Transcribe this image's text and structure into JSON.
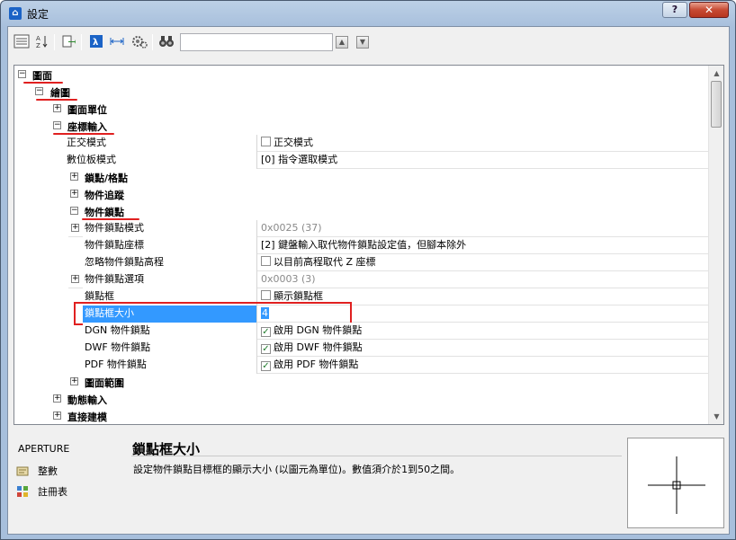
{
  "window": {
    "title": "設定",
    "help_label": "?",
    "close_label": "✕"
  },
  "toolbar": {
    "buttons": [
      "view-toggle-icon",
      "sort-az-icon",
      "export-icon",
      "drawing-icon",
      "dimension-icon",
      "settings-gear-icon",
      "binoculars-icon"
    ],
    "search_value": "",
    "up_label": "▲",
    "down_label": "▼"
  },
  "tree": {
    "root": "圖面",
    "drawing": "繪圖",
    "units": "圖面單位",
    "coord_input": "座標輸入",
    "ortho": {
      "name": "正交模式",
      "value": "正交模式",
      "checked": false
    },
    "tablet": {
      "name": "數位板模式",
      "value": "[0] 指令選取模式"
    },
    "snap_grid": "鎖點/格點",
    "tracking": "物件追蹤",
    "osnap": "物件鎖點",
    "osnap_mode": {
      "name": "物件鎖點模式",
      "value": "0x0025 (37)"
    },
    "osnap_coords": {
      "name": "物件鎖點座標",
      "value": "[2] 鍵盤輸入取代物件鎖點設定值，但腳本除外"
    },
    "osnap_elev": {
      "name": "忽略物件鎖點高程",
      "value": "以目前高程取代 Z 座標",
      "checked": false
    },
    "osnap_options": {
      "name": "物件鎖點選項",
      "value": "0x0003 (3)"
    },
    "aperture_box": {
      "name": "鎖點框",
      "value": "顯示鎖點框",
      "checked": false
    },
    "aperture_size": {
      "name": "鎖點框大小",
      "value": "4"
    },
    "dgn_snap": {
      "name": "DGN 物件鎖點",
      "value": "啟用 DGN 物件鎖點",
      "checked": true
    },
    "dwf_snap": {
      "name": "DWF 物件鎖點",
      "value": "啟用 DWF 物件鎖點",
      "checked": true
    },
    "pdf_snap": {
      "name": "PDF 物件鎖點",
      "value": "啟用 PDF 物件鎖點",
      "checked": true
    },
    "limits": "圖面範圍",
    "dynamic_input": "動態輸入",
    "direct_modeling": "直接建模"
  },
  "info": {
    "variable": "APERTURE",
    "link_integer": "整數",
    "link_registry": "註冊表",
    "title": "鎖點框大小",
    "description": "設定物件鎖點目標框的顯示大小 (以圖元為單位)。數值須介於1到50之間。"
  },
  "colors": {
    "selection": "#3399ff",
    "annotation": "#e02020"
  }
}
